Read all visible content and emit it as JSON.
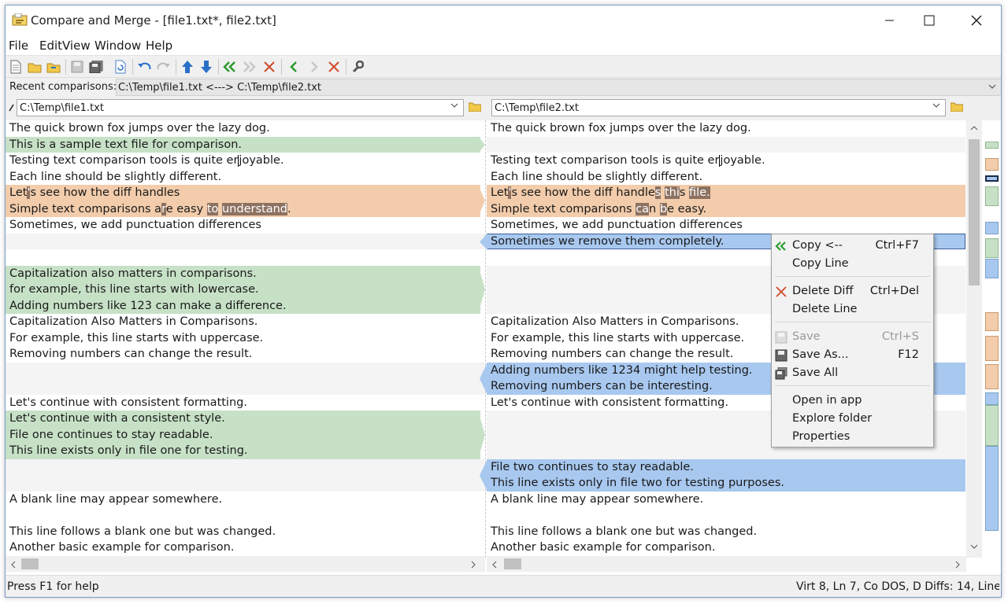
{
  "window": {
    "title": "Compare and Merge - [file1.txt*, file2.txt]",
    "minimize_icon": "minimize-icon",
    "maximize_icon": "maximize-icon",
    "close_icon": "close-icon"
  },
  "menu": [
    "File",
    "Edit",
    "View",
    "Window",
    "Help"
  ],
  "toolbar_icons": [
    "new-file-icon",
    "open-folder-icon",
    "open-both-icon",
    "save-icon",
    "save-all-icon",
    "refresh-icon",
    "undo-icon",
    "redo-icon",
    "prev-diff-icon",
    "next-diff-icon",
    "copy-all-left-icon",
    "copy-all-right-icon",
    "delete-all-icon",
    "copy-left-icon",
    "copy-right-icon",
    "delete-icon",
    "options-icon"
  ],
  "recent": {
    "label": "Recent comparisons:",
    "value": "C:\\Temp\\file1.txt <---> C:\\Temp\\file2.txt"
  },
  "left_path": "C:\\Temp\\file1.txt",
  "right_path": "C:\\Temp\\file2.txt",
  "left_lines": [
    "The quick brown fox jumps over the lazy dog.",
    "This is a sample text file for comparison.",
    "Testing text comparison tools is quite enjoyable.",
    "Each line should be slightly different.",
    "Let's see how the diff handles",
    "Simple text comparisons are easy to understand.",
    "Sometimes, we add punctuation differences",
    "",
    "",
    "Capitalization also matters in comparisons.",
    "for example, this line starts with lowercase.",
    "Adding numbers like 123 can make a difference.",
    "Capitalization Also Matters in Comparisons.",
    "For example, this line starts with uppercase.",
    "Removing numbers can change the result.",
    "",
    "",
    "Let's continue with consistent formatting.",
    "Let's continue with a consistent style.",
    "File one continues to stay readable.",
    "This line exists only in file one for testing.",
    "",
    "",
    "A blank line may appear somewhere.",
    "",
    "This line follows a blank one but was changed.",
    "Another basic example for comparison."
  ],
  "right_lines": [
    "The quick brown fox jumps over the lazy dog.",
    "",
    "Testing text comparison tools is quite enjoyable.",
    "Each line should be slightly different.",
    "Let's see how the diff handles this file.",
    "Simple text comparisons can be easy.",
    "Sometimes, we add punctuation differences",
    "Sometimes we remove them completely.",
    "",
    "",
    "",
    "",
    "Capitalization Also Matters in Comparisons.",
    "For example, this line starts with uppercase.",
    "Removing numbers can change the result.",
    "Adding numbers like 1234 might help testing.",
    "Removing numbers can be interesting.",
    "Let's continue with consistent formatting.",
    "",
    "",
    "",
    "File two continues to stay readable.",
    "This line exists only in file two for testing purposes.",
    "A blank line may appear somewhere.",
    "",
    "This line follows a blank one but was changed.",
    "Another basic example for comparison."
  ],
  "context_menu": {
    "copy": {
      "label": "Copy <--",
      "shortcut": "Ctrl+F7"
    },
    "copy_line": {
      "label": "Copy Line"
    },
    "delete_diff": {
      "label": "Delete Diff",
      "shortcut": "Ctrl+Del"
    },
    "delete_line": {
      "label": "Delete Line"
    },
    "save": {
      "label": "Save",
      "shortcut": "Ctrl+S"
    },
    "save_as": {
      "label": "Save As...",
      "shortcut": "F12"
    },
    "save_all": {
      "label": "Save All"
    },
    "open_in_app": {
      "label": "Open in app"
    },
    "explore_folder": {
      "label": "Explore folder"
    },
    "properties": {
      "label": "Properties"
    }
  },
  "status": {
    "help": "Press F1 for help",
    "position": "Virt 8, Ln 7, Co DOS, D Diffs: 14, Line"
  },
  "colors": {
    "added": "#c7e1c7",
    "changed": "#f2ccab",
    "removed": "#a8c8ef",
    "inline_change": "#8d7262"
  }
}
